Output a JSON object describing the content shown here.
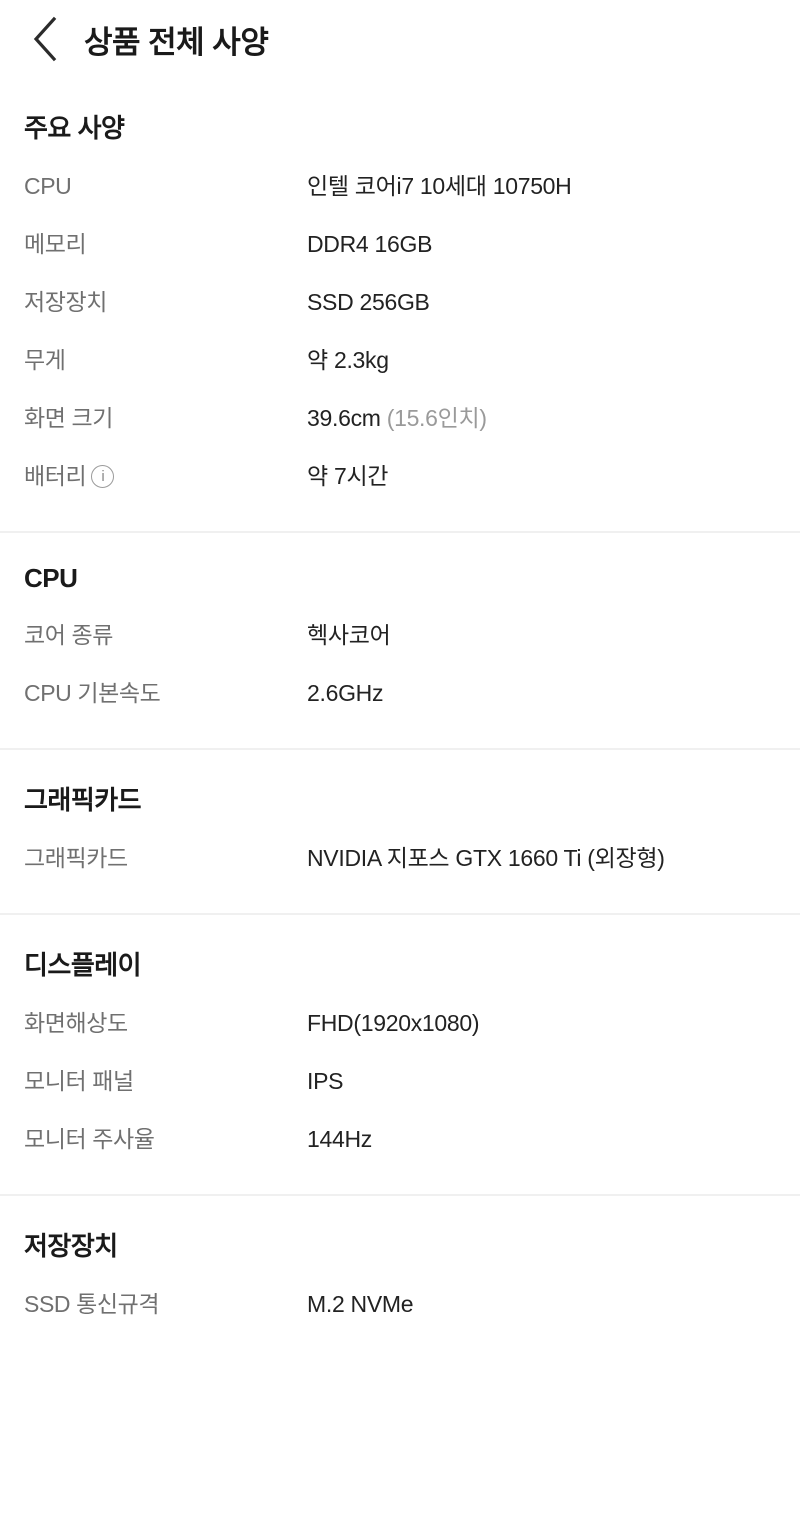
{
  "header": {
    "back_icon": "chevron-left-icon",
    "title": "상품 전체 사양"
  },
  "sections": [
    {
      "title": "주요 사양",
      "rows": [
        {
          "label": "CPU",
          "value": "인텔 코어i7 10세대 10750H"
        },
        {
          "label": "메모리",
          "value": "DDR4 16GB"
        },
        {
          "label": "저장장치",
          "value": "SSD 256GB"
        },
        {
          "label": "무게",
          "value": "약 2.3kg"
        },
        {
          "label": "화면 크기",
          "value": "39.6cm",
          "value_sub": "(15.6인치)"
        },
        {
          "label": "배터리",
          "info_icon": "info-circle-icon",
          "value": "약 7시간"
        }
      ]
    },
    {
      "title": "CPU",
      "rows": [
        {
          "label": "코어 종류",
          "value": "헥사코어"
        },
        {
          "label": "CPU 기본속도",
          "value": "2.6GHz"
        }
      ]
    },
    {
      "title": "그래픽카드",
      "rows": [
        {
          "label": "그래픽카드",
          "value": "NVIDIA 지포스 GTX 1660 Ti (외장형)"
        }
      ]
    },
    {
      "title": "디스플레이",
      "rows": [
        {
          "label": "화면해상도",
          "value": "FHD(1920x1080)"
        },
        {
          "label": "모니터 패널",
          "value": "IPS"
        },
        {
          "label": "모니터 주사율",
          "value": "144Hz"
        }
      ]
    },
    {
      "title": "저장장치",
      "rows": [
        {
          "label": "SSD 통신규격",
          "value": "M.2 NVMe"
        }
      ]
    }
  ],
  "colors": {
    "background": "#ffffff",
    "title_text": "#1a1a1a",
    "label_text": "#707070",
    "value_text": "#222222",
    "value_sub_text": "#9a9a9a",
    "divider": "#f0f0f0"
  }
}
